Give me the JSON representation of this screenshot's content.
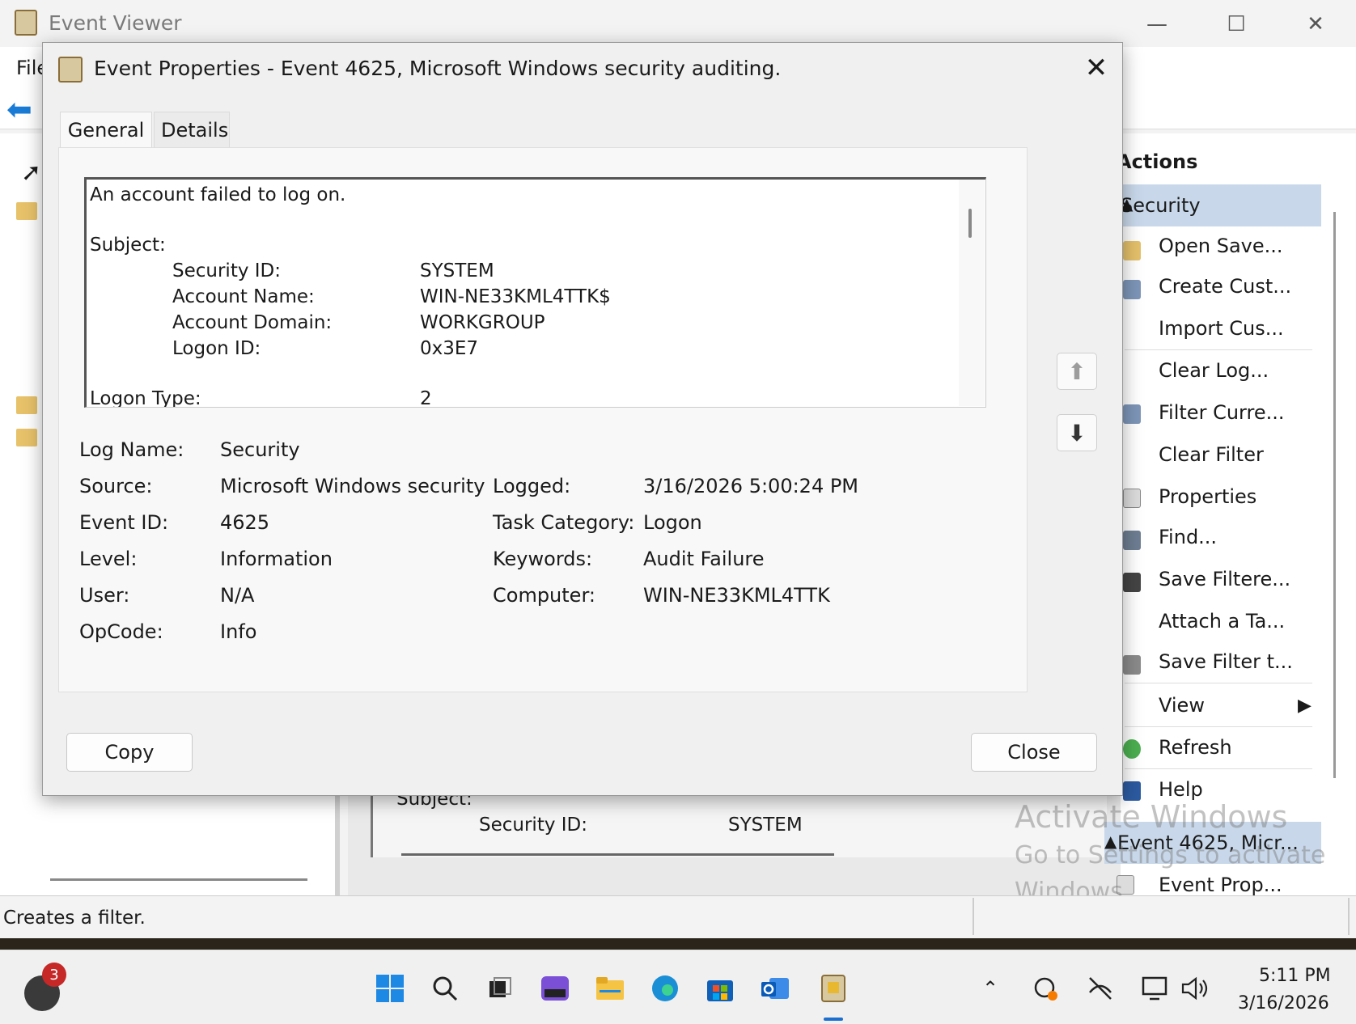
{
  "main_window": {
    "title": "Event Viewer",
    "menu_file": "File",
    "status_text": "Creates a filter."
  },
  "actions": {
    "title": "Actions",
    "section_security": "Security",
    "items": [
      "Open Save...",
      "Create Cust...",
      "Import Cus...",
      "Clear Log...",
      "Filter Curre...",
      "Clear Filter",
      "Properties",
      "Find...",
      "Save Filtere...",
      "Attach a Ta...",
      "Save Filter t...",
      "View",
      "Refresh",
      "Help"
    ],
    "section_event": "Event 4625, Micr...",
    "event_items": [
      "Event Prop..."
    ]
  },
  "preview": {
    "subject_label": "Subject:",
    "security_id_label": "Security ID:",
    "security_id_value": "SYSTEM"
  },
  "watermark": {
    "line1": "Activate Windows",
    "line2": "Go to Settings to activate",
    "line3": "Windows."
  },
  "dialog": {
    "title": "Event Properties - Event 4625, Microsoft Windows security auditing.",
    "tabs": [
      "General",
      "Details"
    ],
    "description": {
      "headline": "An account failed to log on.",
      "subject_label": "Subject:",
      "fields": [
        {
          "label": "Security ID:",
          "value": "SYSTEM"
        },
        {
          "label": "Account Name:",
          "value": "WIN-NE33KML4TTK$"
        },
        {
          "label": "Account Domain:",
          "value": "WORKGROUP"
        },
        {
          "label": "Logon ID:",
          "value": "0x3E7"
        }
      ],
      "logon_type_label": "Logon Type:",
      "logon_type_value": "2"
    },
    "properties": {
      "log_name_label": "Log Name:",
      "log_name": "Security",
      "source_label": "Source:",
      "source": "Microsoft Windows security",
      "logged_label": "Logged:",
      "logged": "3/16/2026 5:00:24 PM",
      "event_id_label": "Event ID:",
      "event_id": "4625",
      "task_category_label": "Task Category:",
      "task_category": "Logon",
      "level_label": "Level:",
      "level": "Information",
      "keywords_label": "Keywords:",
      "keywords": "Audit Failure",
      "user_label": "User:",
      "user": "N/A",
      "computer_label": "Computer:",
      "computer": "WIN-NE33KML4TTK",
      "opcode_label": "OpCode:",
      "opcode": "Info"
    },
    "copy_label": "Copy",
    "close_label": "Close"
  },
  "taskbar": {
    "badge_count": "3",
    "time": "5:11 PM",
    "date": "3/16/2026"
  }
}
